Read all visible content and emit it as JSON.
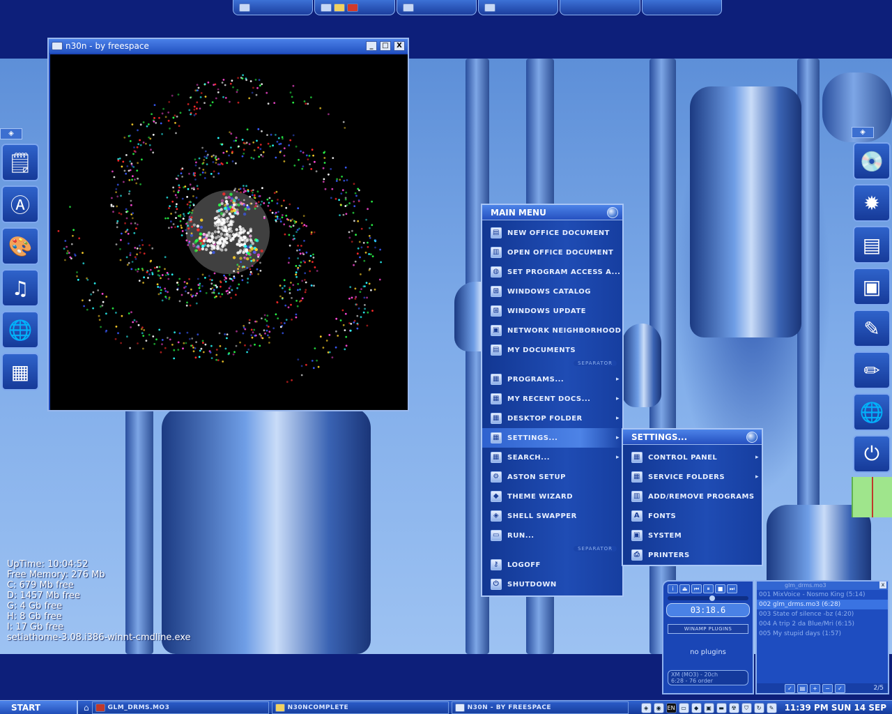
{
  "top_bar": {
    "segments": [
      {
        "icons": [
          "control-panel-icon"
        ]
      },
      {
        "icons": [
          "ie-icon",
          "folder-icon",
          "bug-icon"
        ]
      },
      {
        "icons": [
          "display-icon"
        ]
      },
      {
        "icons": [
          "keyboard-icon"
        ]
      },
      {
        "icons": []
      },
      {
        "icons": []
      }
    ]
  },
  "left_dock": {
    "items": [
      "notepad-icon",
      "aston-logo-icon",
      "paint-icon",
      "speaker-icon",
      "globe-icon",
      "blocks-icon"
    ]
  },
  "right_dock": {
    "items": [
      "cd-drive-icon",
      "virus-icon",
      "memory-chip-icon",
      "pda-icon",
      "pen-icon",
      "brushes-icon",
      "globe-icon",
      "power-icon"
    ]
  },
  "n30n_window": {
    "title": "n30n - by freespace",
    "buttons": [
      "_",
      "□",
      "X"
    ]
  },
  "main_menu": {
    "title": "MAIN MENU",
    "items": [
      {
        "label": "NEW OFFICE DOCUMENT",
        "icon": "office-new-icon"
      },
      {
        "label": "OPEN OFFICE DOCUMENT",
        "icon": "office-open-icon"
      },
      {
        "label": "SET PROGRAM ACCESS A...",
        "icon": "program-access-icon"
      },
      {
        "label": "WINDOWS CATALOG",
        "icon": "windows-logo-icon"
      },
      {
        "label": "WINDOWS UPDATE",
        "icon": "windows-update-icon"
      },
      {
        "label": "NETWORK NEIGHBORHOOD",
        "icon": "network-icon"
      },
      {
        "label": "MY DOCUMENTS",
        "icon": "documents-icon"
      }
    ],
    "separator_1": "SEPARATOR",
    "items_2": [
      {
        "label": "PROGRAMS...",
        "icon": "folder-icon",
        "submenu": true
      },
      {
        "label": "MY RECENT DOCS...",
        "icon": "folder-icon",
        "submenu": true
      },
      {
        "label": "DESKTOP FOLDER",
        "icon": "folder-icon",
        "submenu": true
      },
      {
        "label": "SETTINGS...",
        "icon": "folder-icon",
        "submenu": true,
        "selected": true
      },
      {
        "label": "SEARCH...",
        "icon": "folder-icon",
        "submenu": true
      },
      {
        "label": "ASTON SETUP",
        "icon": "gear-icon"
      },
      {
        "label": "THEME WIZARD",
        "icon": "diamond-icon"
      },
      {
        "label": "SHELL SWAPPER",
        "icon": "swap-icon"
      },
      {
        "label": "RUN...",
        "icon": "run-icon"
      }
    ],
    "separator_2": "SEPARATOR",
    "items_3": [
      {
        "label": "LOGOFF",
        "icon": "key-icon"
      },
      {
        "label": "SHUTDOWN",
        "icon": "power-icon"
      }
    ]
  },
  "settings_menu": {
    "title": "SETTINGS...",
    "items": [
      {
        "label": "CONTROL PANEL",
        "icon": "folder-icon",
        "submenu": true
      },
      {
        "label": "SERVICE FOLDERS",
        "icon": "folder-icon",
        "submenu": true
      },
      {
        "label": "ADD/REMOVE PROGRAMS",
        "icon": "add-remove-icon"
      },
      {
        "label": "FONTS",
        "icon": "fonts-folder-icon"
      },
      {
        "label": "SYSTEM",
        "icon": "system-icon"
      },
      {
        "label": "PRINTERS",
        "icon": "printer-icon"
      }
    ]
  },
  "sysinfo": {
    "uptime": "UpTime: 10:04:52",
    "memory": "Free Memory: 276 Mb",
    "drives": [
      "C: 679 Mb free",
      "D: 1457 Mb free",
      "G: 4 Gb free",
      "H: 8 Gb free",
      "I: 17 Gb free"
    ],
    "process": "setiathome-3.08.i386-winnt-cmdline.exe"
  },
  "winamp": {
    "time": "03:18.6",
    "plugins_header": "WINAMP PLUGINS",
    "plugins_text": "no plugins",
    "info_line1": "XM (MO3) - 20ch",
    "info_line2": "6:28 - 76 order",
    "playlist_title": "glm_drms.mo3",
    "playlist": [
      "001 MixVoice - Nosmo King (5:14)",
      "002 glm_drms.mo3 (6:28)",
      "003 State of silence -bz (4:20)",
      "004 A trip 2 da Blue/Mri (6:15)",
      "005 My stupid days (1:57)"
    ],
    "current_index": 1,
    "page": "2/5"
  },
  "taskbar": {
    "start": "START",
    "tasks": [
      {
        "label": "GLM_DRMS.MO3",
        "icon": "winamp-icon"
      },
      {
        "label": "N30NCOMPLETE",
        "icon": "folder-icon"
      },
      {
        "label": "N30N - BY FREESPACE",
        "icon": "ie-window-icon"
      }
    ],
    "tray_lang": "EN",
    "clock": "11:39 PM SUN 14 SEP"
  },
  "colors": {
    "desktop_dark": "#0d1f7a",
    "menu_accent": "#2f62cf",
    "menu_border": "#a9c6f6"
  }
}
